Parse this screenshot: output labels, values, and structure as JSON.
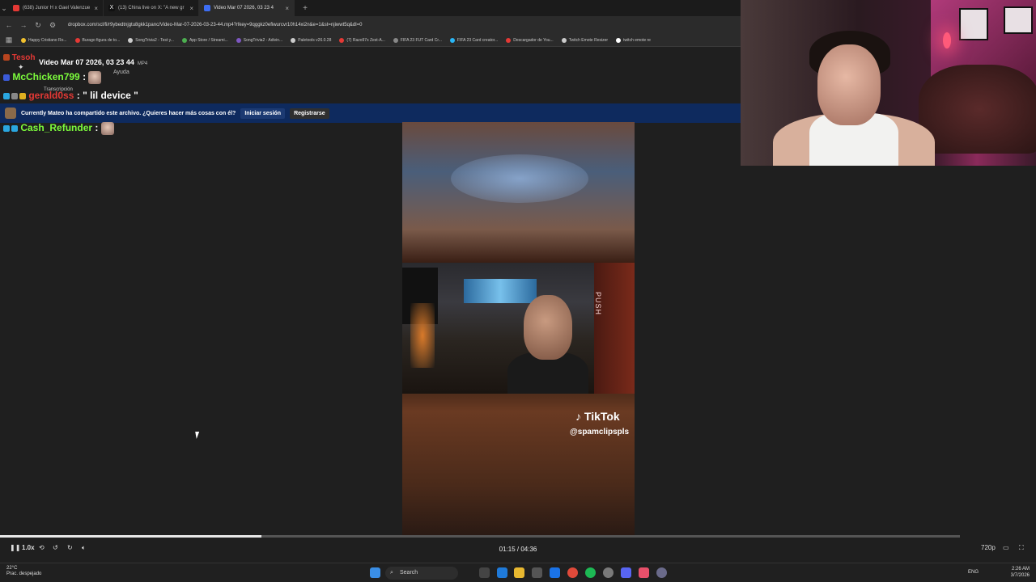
{
  "browser": {
    "tabs": [
      {
        "title": "(638) Junior H x Gael Valenzue",
        "color": "#e53935",
        "active": false
      },
      {
        "title": "(13) China live on X: \"A new gr",
        "color": "#ffffff",
        "active": false
      },
      {
        "title": "Video Mar 07 2026, 03 23 4",
        "color": "#3d6df2",
        "active": true
      }
    ],
    "new_tab": "+",
    "url": "dropbox.com/scl/fi/r9ybedtnjgtu8gkk1panc/Video-Mar-07-2026-03-23-44.mp4?rlkey=9qggkz0efiwurcvr10h14xi2n&e=1&st=njiwwt5q&dl=0",
    "bookmarks": [
      {
        "label": "Happy Cristiano Ro...",
        "color": "#f2c12e"
      },
      {
        "label": "Burago figura de to...",
        "color": "#e53935"
      },
      {
        "label": "SongTrivia2 - Test y...",
        "color": "#cccccc"
      },
      {
        "label": "App Store / Streami...",
        "color": "#4caf50"
      },
      {
        "label": "SongTrivia2 - Adivin...",
        "color": "#7e57c2"
      },
      {
        "label": "Paletools v26.0.28",
        "color": "#cccccc"
      },
      {
        "label": "(7) Razo97s Zest-A...",
        "color": "#e53935"
      },
      {
        "label": "FIFA 23 FUT Card Cr...",
        "color": "#888888"
      },
      {
        "label": "FIFA 23 Card creator...",
        "color": "#29b6f6"
      },
      {
        "label": "Descargador de You...",
        "color": "#e53935"
      },
      {
        "label": "Twitch Emote Resizer",
        "color": "#cccccc"
      },
      {
        "label": "twitch emote re",
        "color": "#ffffff"
      }
    ]
  },
  "file": {
    "title": "Video Mar 07 2026, 03 23 44",
    "type": "MP4",
    "help": "Ayuda",
    "transcription": "Transcripción"
  },
  "banner": {
    "text": "Currently Mateo ha compartido este archivo. ¿Quieres hacer más cosas con él?",
    "login": "Iniciar sesión",
    "register": "Registrarse"
  },
  "chat": [
    {
      "user": "Tesoh",
      "color": "#e53935",
      "message": ""
    },
    {
      "user": "McChicken799",
      "color": "#7cfc3c",
      "message": ""
    },
    {
      "user": "gerald0ss",
      "color": "#e53935",
      "message": "\" lil device \""
    },
    {
      "user": "Cash_Refunder",
      "color": "#7cfc3c",
      "message": ""
    }
  ],
  "video": {
    "brand": "TikTok",
    "handle": "@spamclipspls",
    "door_text": "PUSH"
  },
  "player": {
    "current": "01:15",
    "duration": "04:36",
    "time_display": "01:15 / 04:36",
    "speed": "1.0x",
    "quality": "720p",
    "progress": 0.272
  },
  "taskbar": {
    "temp": "22°C",
    "weather": "Prac. despejado",
    "search": "Search",
    "lang": "ENG",
    "time": "2:26 AM",
    "date": "3/7/2026"
  }
}
